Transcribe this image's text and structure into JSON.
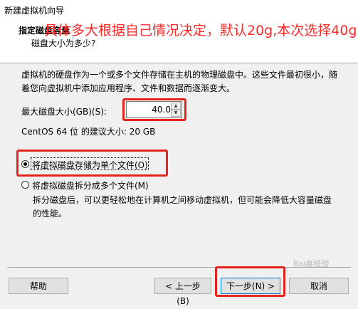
{
  "window": {
    "title": "新建虚拟机向导"
  },
  "header": {
    "title": "指定磁盘容量",
    "subtitle": "磁盘大小为多少?"
  },
  "annotation": {
    "text": "具体多大根据自己情况决定，默认20g,本次选择40g",
    "color": "#ff2a2a"
  },
  "main": {
    "description": "虚拟机的硬盘作为一个或多个文件存储在主机的物理磁盘中。这些文件最初很小，随着您向虚拟机中添加应用程序、文件和数据而逐渐变大。",
    "max_disk_label": "最大磁盘大小(GB)(S):",
    "max_disk_value": "40.0",
    "recommended": "CentOS 64 位 的建议大小: 20 GB",
    "options": [
      {
        "label": "将虚拟磁盘存储为单个文件(O)",
        "selected": true
      },
      {
        "label": "将虚拟磁盘拆分成多个文件(M)",
        "selected": false
      }
    ],
    "split_description": "拆分磁盘后，可以更轻松地在计算机之间移动虚拟机，但可能会降低大容量磁盘的性能。"
  },
  "footer": {
    "help": "帮助",
    "back": "< 上一步(B)",
    "next": "下一步(N) >",
    "cancel": "取消"
  },
  "watermark": "Bai度经验",
  "colors": {
    "highlight": "#e5251d",
    "default_button_border": "#0078d7"
  }
}
